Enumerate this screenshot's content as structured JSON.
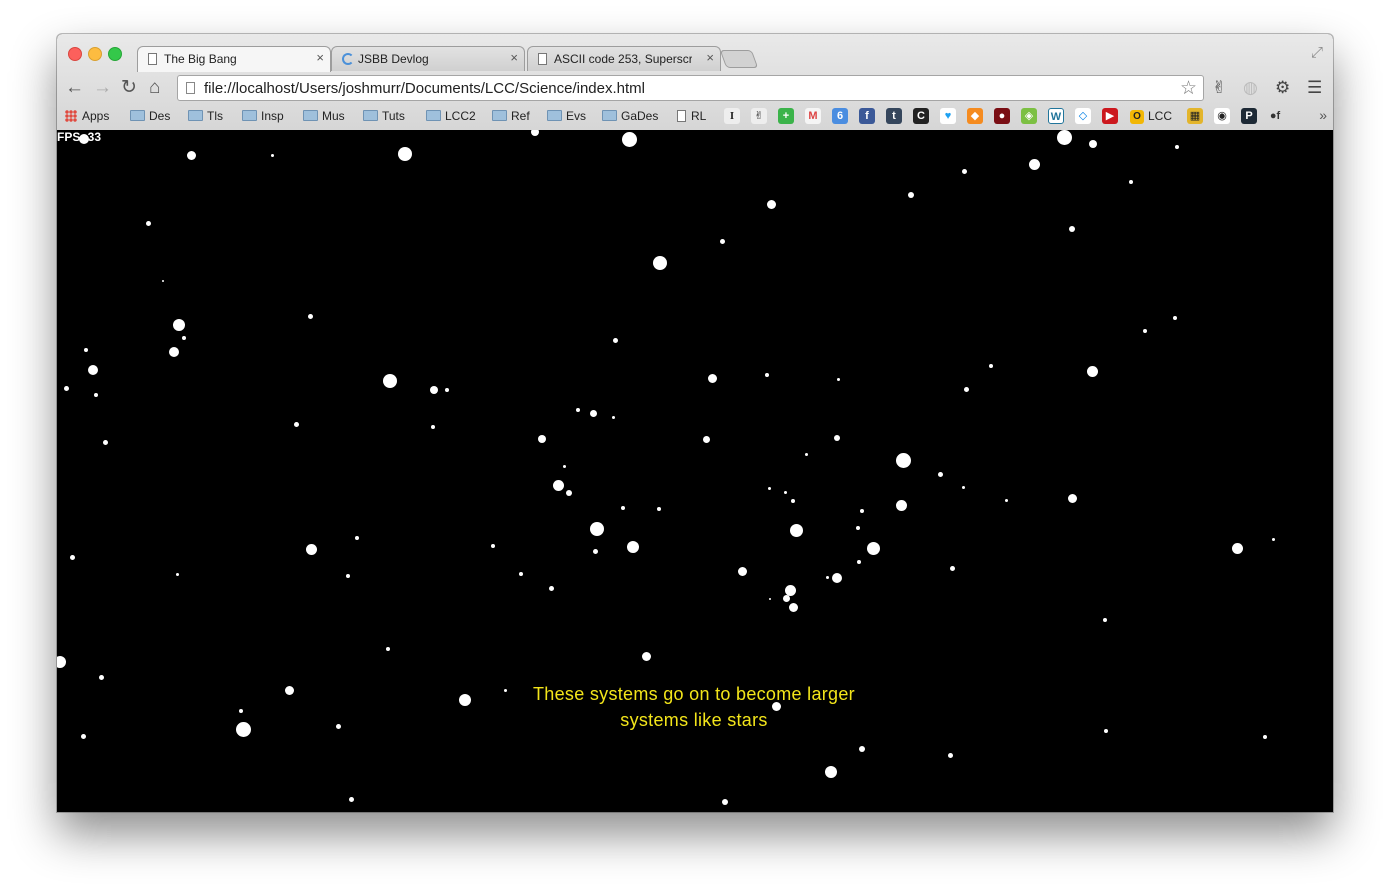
{
  "browser": {
    "tabs": [
      {
        "title": "The Big Bang",
        "active": true,
        "close": "×"
      },
      {
        "title": "JSBB Devlog",
        "active": false,
        "close": "×"
      },
      {
        "title": "ASCII code 253, Superscript",
        "active": false,
        "close": "×"
      }
    ],
    "url": "file://localhost/Users/joshmurr/Documents/LCC/Science/index.html",
    "nav": {
      "back": "←",
      "forward": "→",
      "reload": "↻",
      "home": "⌂"
    },
    "star_icon": "☆",
    "bookmarks": [
      "Apps",
      "Des",
      "Tls",
      "Insp",
      "Mus",
      "Tuts",
      "LCC2",
      "Ref",
      "Evs",
      "GaDes",
      "RL",
      "LCC"
    ],
    "bookmark_more": "»"
  },
  "page": {
    "fps_label": "FPS: 33",
    "caption_line1": "These systems go on to become larger",
    "caption_line2": "systems like stars",
    "background_color": "#000000",
    "star_color": "#ffffff",
    "caption_color": "#f3e51a"
  }
}
